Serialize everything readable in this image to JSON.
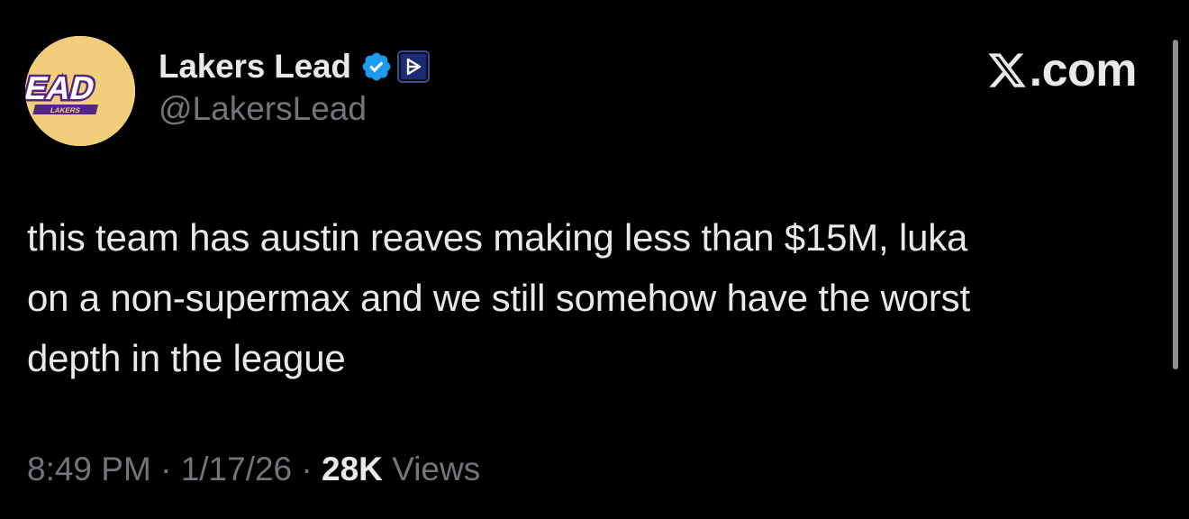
{
  "account": {
    "display_name": "Lakers Lead",
    "handle": "@LakersLead",
    "avatar_text": "LEAD",
    "avatar_subtext": "LAKERS"
  },
  "brand": {
    "suffix": ".com"
  },
  "tweet": {
    "text": "this team has austin reaves making less than $15M, luka\non a non-supermax and we still somehow have the worst\ndepth in the league"
  },
  "meta": {
    "time": "8:49 PM",
    "sep1": " · ",
    "date": "1/17/26",
    "sep2": " · ",
    "views_count": "28K",
    "views_label": " Views"
  },
  "colors": {
    "background": "#000000",
    "primary_text": "#e7e9ea",
    "secondary_text": "#71767b",
    "verified_blue": "#1d9bf0",
    "avatar_gold": "#f1cf7a",
    "lakers_purple": "#552583"
  },
  "icons": {
    "verified": "verified-badge-icon",
    "affiliate": "affiliate-badge-icon",
    "brand": "x-logo-icon"
  }
}
